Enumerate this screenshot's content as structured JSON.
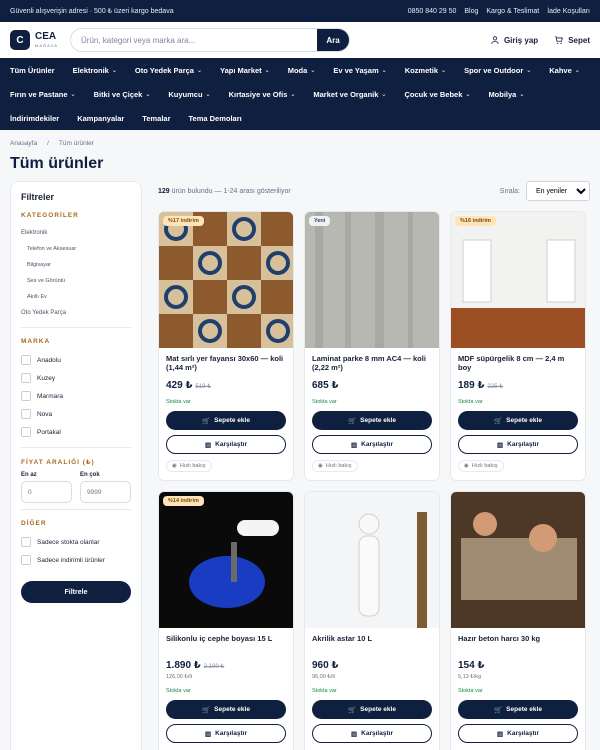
{
  "topbar": {
    "notice": "Güvenli alışverişin adresi · 500 ₺ üzeri kargo bedava",
    "phone": "0850 840 29 50",
    "links": [
      "Blog",
      "Kargo & Teslimat",
      "İade Koşulları"
    ]
  },
  "header": {
    "logo_mark": "C",
    "brand": "CEA",
    "brand_sub": "MAĞAZA",
    "search_placeholder": "Ürün, kategori veya marka ara...",
    "search_button": "Ara",
    "login_label": "Giriş yap",
    "cart_label": "Sepet"
  },
  "nav": {
    "row1": [
      {
        "label": "Tüm Ürünler",
        "chevron": false
      },
      {
        "label": "Elektronik",
        "chevron": true
      },
      {
        "label": "Oto Yedek Parça",
        "chevron": true
      },
      {
        "label": "Yapı Market",
        "chevron": true
      },
      {
        "label": "Moda",
        "chevron": true
      },
      {
        "label": "Ev ve Yaşam",
        "chevron": true
      },
      {
        "label": "Kozmetik",
        "chevron": true
      },
      {
        "label": "Spor ve Outdoor",
        "chevron": true
      },
      {
        "label": "Kahve",
        "chevron": true
      }
    ],
    "row2": [
      {
        "label": "Fırın ve Pastane",
        "chevron": true
      },
      {
        "label": "Bitki ve Çiçek",
        "chevron": true
      },
      {
        "label": "Kuyumcu",
        "chevron": true
      },
      {
        "label": "Kırtasiye ve Ofis",
        "chevron": true
      },
      {
        "label": "Market ve Organik",
        "chevron": true
      },
      {
        "label": "Çocuk ve Bebek",
        "chevron": true
      },
      {
        "label": "Mobilya",
        "chevron": true
      }
    ],
    "row3": [
      {
        "label": "İndirimdekiler",
        "chevron": false
      },
      {
        "label": "Kampanyalar",
        "chevron": false
      },
      {
        "label": "Temalar",
        "chevron": false
      },
      {
        "label": "Tema Demoları",
        "chevron": false
      }
    ]
  },
  "breadcrumb": {
    "home": "Anasayfa",
    "sep": "/",
    "current": "Tüm ürünler"
  },
  "page_title": "Tüm ürünler",
  "sidebar": {
    "title": "Filtreler",
    "categories_title": "KATEGORİLER",
    "categories": [
      {
        "label": "Elektronik",
        "sub": false
      },
      {
        "label": "Telefon ve Aksesuar",
        "sub": true
      },
      {
        "label": "Bilgisayar",
        "sub": true
      },
      {
        "label": "Ses ve Görüntü",
        "sub": true
      },
      {
        "label": "Akıllı Ev",
        "sub": true
      },
      {
        "label": "Oto Yedek Parça",
        "sub": false
      }
    ],
    "brand_title": "MARKA",
    "brands": [
      "Anadolu",
      "Kuzey",
      "Marmara",
      "Nova",
      "Portakal"
    ],
    "price_title": "FİYAT ARALIĞI (₺)",
    "price_min_label": "En az",
    "price_max_label": "En çok",
    "price_min_placeholder": "0",
    "price_max_placeholder": "9999",
    "other_title": "DİĞER",
    "other_options": [
      "Sadece stokta olanlar",
      "Sadece indirimli ürünler"
    ],
    "filter_button": "Filtrele"
  },
  "toolbar": {
    "count": "129",
    "count_text": "ürün bulundu — 1-24 arası gösteriliyor",
    "sort_label": "Sırala:",
    "sort_value": "En yeniler"
  },
  "products": [
    {
      "badge": "%17 indirim",
      "badge_type": "discount",
      "title": "Mat sırlı yer fayansı 30x60 — koli (1,44 m²)",
      "price": "429 ₺",
      "old_price": "519 ₺",
      "unit": "",
      "stock": "Stokta var",
      "add_to_cart": "Sepete ekle",
      "compare": "Karşılaştır",
      "quick_view": "Hızlı bakış",
      "image": "tile"
    },
    {
      "badge": "Yeni",
      "badge_type": "new",
      "title": "Laminat parke 8 mm AC4 — koli (2,22 m²)",
      "price": "685 ₺",
      "old_price": "",
      "unit": "",
      "stock": "Stokta var",
      "add_to_cart": "Sepete ekle",
      "compare": "Karşılaştır",
      "quick_view": "Hızlı bakış",
      "image": "laminate"
    },
    {
      "badge": "%16 indirim",
      "badge_type": "discount",
      "title": "MDF süpürgelik 8 cm — 2,4 m boy",
      "price": "189 ₺",
      "old_price": "225 ₺",
      "unit": "",
      "stock": "Stokta var",
      "add_to_cart": "Sepete ekle",
      "compare": "Karşılaştır",
      "quick_view": "Hızlı bakış",
      "image": "room"
    },
    {
      "badge": "%14 indirim",
      "badge_type": "discount",
      "title": "Silikonlu iç cephe boyası 15 L",
      "price": "1.890 ₺",
      "old_price": "2.190 ₺",
      "unit": "126,00 ₺/lt",
      "stock": "Stokta var",
      "add_to_cart": "Sepete ekle",
      "compare": "Karşılaştır",
      "quick_view": "",
      "image": "paint"
    },
    {
      "badge": "",
      "badge_type": "",
      "title": "Akrilik astar 10 L",
      "price": "960 ₺",
      "old_price": "",
      "unit": "96,00 ₺/lt",
      "stock": "Stokta var",
      "add_to_cart": "Sepete ekle",
      "compare": "Karşılaştır",
      "quick_view": "",
      "image": "painter"
    },
    {
      "badge": "",
      "badge_type": "",
      "title": "Hazır beton harcı 30 kg",
      "price": "154 ₺",
      "old_price": "",
      "unit": "5,13 ₺/kg",
      "stock": "Stokta var",
      "add_to_cart": "Sepete ekle",
      "compare": "Karşılaştır",
      "quick_view": "",
      "image": "concrete"
    }
  ],
  "colors": {
    "navy": "#0f1f3f",
    "accent": "#a96a1e",
    "stock": "#16884a"
  }
}
